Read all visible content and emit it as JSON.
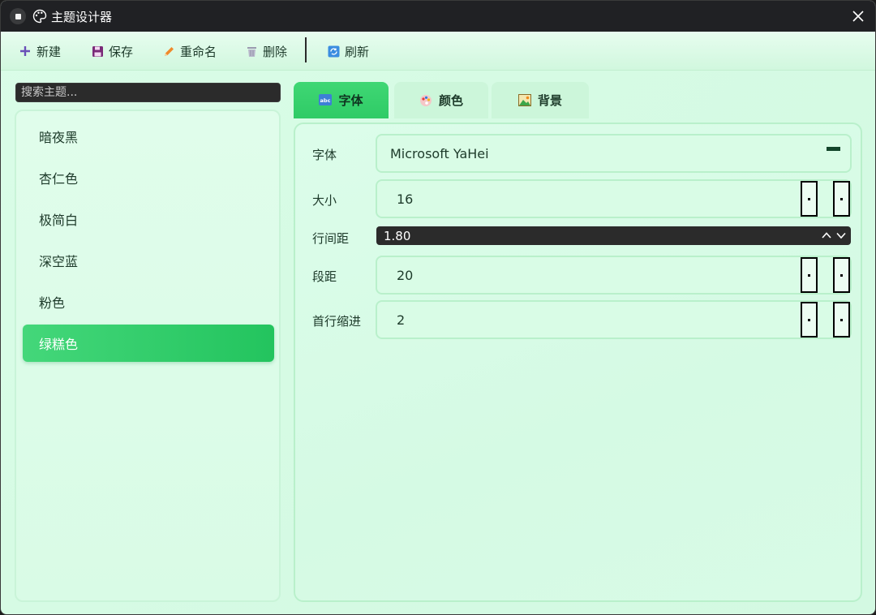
{
  "window": {
    "title": "主题设计器"
  },
  "toolbar": {
    "new_label": "新建",
    "save_label": "保存",
    "rename_label": "重命名",
    "delete_label": "删除",
    "refresh_label": "刷新"
  },
  "search": {
    "placeholder": "搜索主题..."
  },
  "themes": {
    "items": [
      "暗夜黑",
      "杏仁色",
      "极简白",
      "深空蓝",
      "粉色",
      "绿糕色"
    ],
    "selected": "绿糕色"
  },
  "tabs": [
    {
      "label": "字体",
      "icon": "abc-text-icon"
    },
    {
      "label": "颜色",
      "icon": "palette-icon"
    },
    {
      "label": "背景",
      "icon": "picture-icon"
    }
  ],
  "form": {
    "font": {
      "label": "字体",
      "value": "Microsoft YaHei"
    },
    "size": {
      "label": "大小",
      "value": "16"
    },
    "line_spacing": {
      "label": "行间距",
      "value": "1.80"
    },
    "paragraph_spacing": {
      "label": "段距",
      "value": "20"
    },
    "first_indent": {
      "label": "首行缩进",
      "value": "2"
    }
  },
  "colors": {
    "accent": "#2fcb66",
    "title_bar": "#202124",
    "background": "#d8fbe6"
  }
}
